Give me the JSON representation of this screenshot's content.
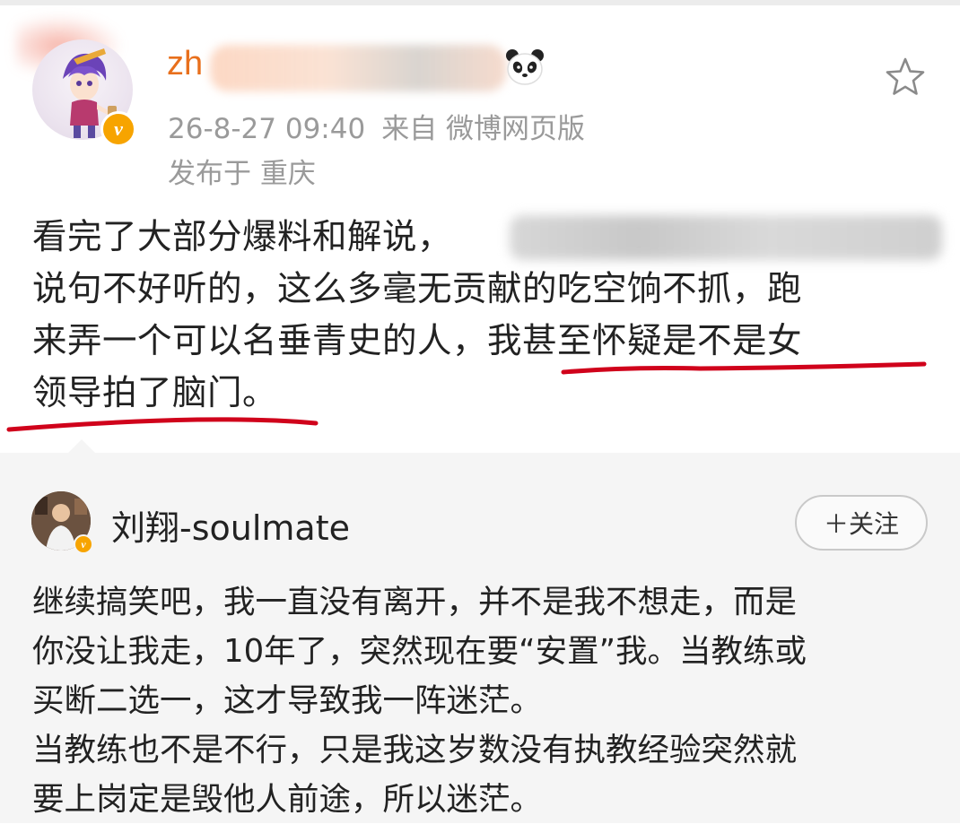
{
  "post": {
    "author_prefix": "zh",
    "timestamp": "26-8-27 09:40",
    "source": "来自 微博网页版",
    "location": "发布于 重庆",
    "lines": [
      "看完了大部分爆料和解说，",
      "说句不好听的，这么多毫无贡献的吃空饷不抓，跑",
      "来弄一个可以名垂青史的人，",
      "领导拍了脑门。"
    ],
    "highlight": "我甚至怀疑是不是女"
  },
  "comment": {
    "author": "刘翔-soulmate",
    "follow_label": "＋关注",
    "lines": [
      "继续搞笑吧，我一直没有离开，并不是我不想走，而是",
      "你没让我走，10年了，突然现在要“安置”我。当教练或",
      "买断二选一，这才导致我一阵迷茫。",
      "当教练也不是不行，只是我这岁数没有执教经验突然就",
      "要上岗定是毁他人前途，所以迷茫。"
    ]
  },
  "colors": {
    "username": "#e86f1c",
    "meta": "#9a9a9a",
    "underline": "#d0021b",
    "verified": "#f7a400"
  },
  "icons": [
    "panda-icon",
    "star-icon",
    "verified-badge-icon",
    "plus-icon"
  ]
}
